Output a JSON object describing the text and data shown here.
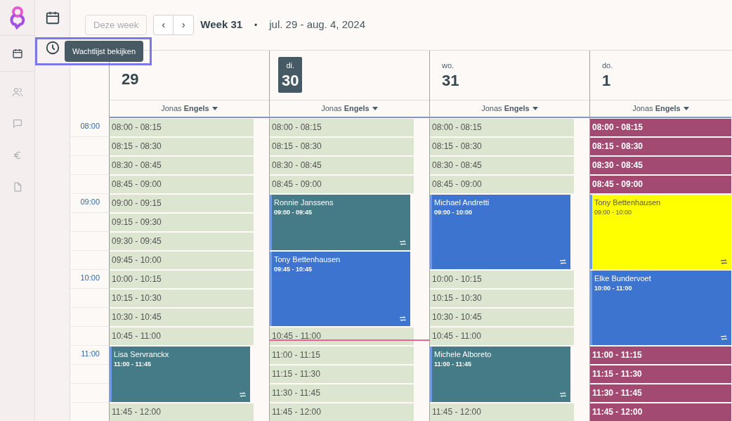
{
  "rail": [
    {
      "kind": "logo"
    },
    {
      "kind": "calendar",
      "selected": true
    },
    {
      "kind": "people",
      "selected": false
    },
    {
      "kind": "chat",
      "selected": false
    },
    {
      "kind": "euro",
      "selected": false
    },
    {
      "kind": "document",
      "selected": false
    }
  ],
  "subnav": [
    {
      "kind": "calendar"
    },
    {
      "kind": "clock"
    }
  ],
  "tooltip": "Wachtlijst bekijken",
  "toolbar": {
    "today_button": {
      "label": "Deze week",
      "disabled": true
    },
    "prev": "‹",
    "next": "›",
    "week": "Week 31",
    "separator": "•",
    "range": "jul. 29 - aug. 4, 2024"
  },
  "time_gutter": [
    "08:00",
    "09:00",
    "10:00",
    "11:00"
  ],
  "days": [
    {
      "date": "29",
      "selected": false,
      "now_line": false,
      "staff": "Jonas **Engels**",
      "items": [
        {
          "kind": "free",
          "time": "08:00 - 08:15"
        },
        {
          "kind": "free",
          "time": "08:15 - 08:30"
        },
        {
          "kind": "free",
          "time": "08:30 - 08:45"
        },
        {
          "kind": "free",
          "time": "08:45 - 09:00"
        },
        {
          "kind": "free",
          "time": "09:00 - 09:15"
        },
        {
          "kind": "free",
          "time": "09:15 - 09:30"
        },
        {
          "kind": "free",
          "time": "09:30 - 09:45"
        },
        {
          "kind": "free",
          "time": "09:45 - 10:00"
        },
        {
          "kind": "free",
          "time": "10:00 - 10:15"
        },
        {
          "kind": "free",
          "time": "10:15 - 10:30"
        },
        {
          "kind": "free",
          "time": "10:30 - 10:45"
        },
        {
          "kind": "free",
          "time": "10:45 - 11:00"
        },
        {
          "kind": "appointment",
          "name": "Lisa Servranckx",
          "time": "11:00 - 11:45",
          "color": "#457b87",
          "recurring": true
        },
        {
          "kind": "free",
          "time": "11:45 - 12:00"
        }
      ]
    },
    {
      "weekday": "di.",
      "date": "30",
      "selected": true,
      "now_line": true,
      "staff": "Jonas **Engels**",
      "items": [
        {
          "kind": "free",
          "time": "08:00 - 08:15"
        },
        {
          "kind": "free",
          "time": "08:15 - 08:30"
        },
        {
          "kind": "free",
          "time": "08:30 - 08:45"
        },
        {
          "kind": "free",
          "time": "08:45 - 09:00"
        },
        {
          "kind": "appointment",
          "name": "Ronnie Janssens",
          "time": "09:00 - 09:45",
          "color": "#457b87",
          "recurring": true
        },
        {
          "kind": "appointment",
          "name": "Tony Bettenhausen",
          "time": "09:45 - 10:45",
          "color": "#3c74d0",
          "recurring": true
        },
        {
          "kind": "free",
          "time": "10:45 - 11:00"
        },
        {
          "kind": "free",
          "time": "11:00 - 11:15"
        },
        {
          "kind": "free",
          "time": "11:15 - 11:30"
        },
        {
          "kind": "free",
          "time": "11:30 - 11:45"
        },
        {
          "kind": "free",
          "time": "11:45 - 12:00"
        }
      ]
    },
    {
      "weekday": "wo.",
      "date": "31",
      "selected": false,
      "now_line": false,
      "staff": "Jonas **Engels**",
      "items": [
        {
          "kind": "free",
          "time": "08:00 - 08:15"
        },
        {
          "kind": "free",
          "time": "08:15 - 08:30"
        },
        {
          "kind": "free",
          "time": "08:30 - 08:45"
        },
        {
          "kind": "free",
          "time": "08:45 - 09:00"
        },
        {
          "kind": "appointment",
          "name": "Michael Andretti",
          "time": "09:00 - 10:00",
          "color": "#3c74d0",
          "recurring": true
        },
        {
          "kind": "free",
          "time": "10:00 - 10:15"
        },
        {
          "kind": "free",
          "time": "10:15 - 10:30"
        },
        {
          "kind": "free",
          "time": "10:30 - 10:45"
        },
        {
          "kind": "free",
          "time": "10:45 - 11:00"
        },
        {
          "kind": "appointment",
          "name": "Michele Alboreto",
          "time": "11:00 - 11:45",
          "color": "#457b87",
          "recurring": true
        },
        {
          "kind": "free",
          "time": "11:45 - 12:00"
        }
      ]
    },
    {
      "weekday": "do.",
      "date": "1",
      "selected": false,
      "now_line": false,
      "staff": "Jonas **Engels**",
      "items": [
        {
          "kind": "blocked",
          "time": "08:00 - 08:15"
        },
        {
          "kind": "blocked",
          "time": "08:15 - 08:30"
        },
        {
          "kind": "blocked",
          "time": "08:30 - 08:45"
        },
        {
          "kind": "blocked",
          "time": "08:45 - 09:00"
        },
        {
          "kind": "appointment",
          "name": "Tony Bettenhausen",
          "time": "09:00 - 10:00",
          "color": "#ffff00",
          "recurring": true
        },
        {
          "kind": "appointment",
          "name": "Elke Bundervoet",
          "time": "10:00 - 11:00",
          "color": "#3c74d0",
          "recurring": true
        },
        {
          "kind": "blocked",
          "time": "11:00 - 11:15"
        },
        {
          "kind": "blocked",
          "time": "11:15 - 11:30"
        },
        {
          "kind": "blocked",
          "time": "11:30 - 11:45"
        },
        {
          "kind": "blocked",
          "time": "11:45 - 12:00"
        }
      ]
    }
  ]
}
